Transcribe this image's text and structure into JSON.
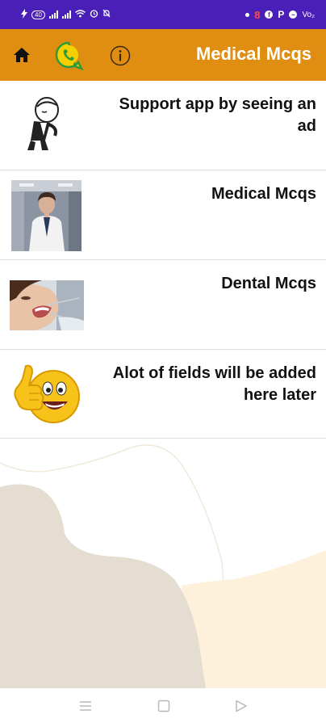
{
  "status_bar": {
    "battery_label": "40",
    "carrier_label": "Vo₂",
    "red_icon": "8"
  },
  "app_bar": {
    "title": "Medical Mcqs",
    "icons": [
      "home-icon",
      "whatsapp-icon",
      "info-icon"
    ]
  },
  "items": [
    {
      "label": "Support app by seeing an ad",
      "image": "cartoon-man-bowing"
    },
    {
      "label": "Medical Mcqs",
      "image": "doctor-in-white-coat"
    },
    {
      "label": "Dental Mcqs",
      "image": "dental-checkup"
    },
    {
      "label": "Alot of fields will be added here later",
      "image": "thumbs-up-emoji"
    }
  ],
  "nav_bar": {
    "icons": [
      "menu-icon",
      "home-square-icon",
      "back-triangle-icon"
    ]
  },
  "colors": {
    "status_bar": "#4a1fb8",
    "app_bar": "#e08e12",
    "wave_left": "#e5ddd1",
    "wave_right": "#fdf1dc"
  }
}
